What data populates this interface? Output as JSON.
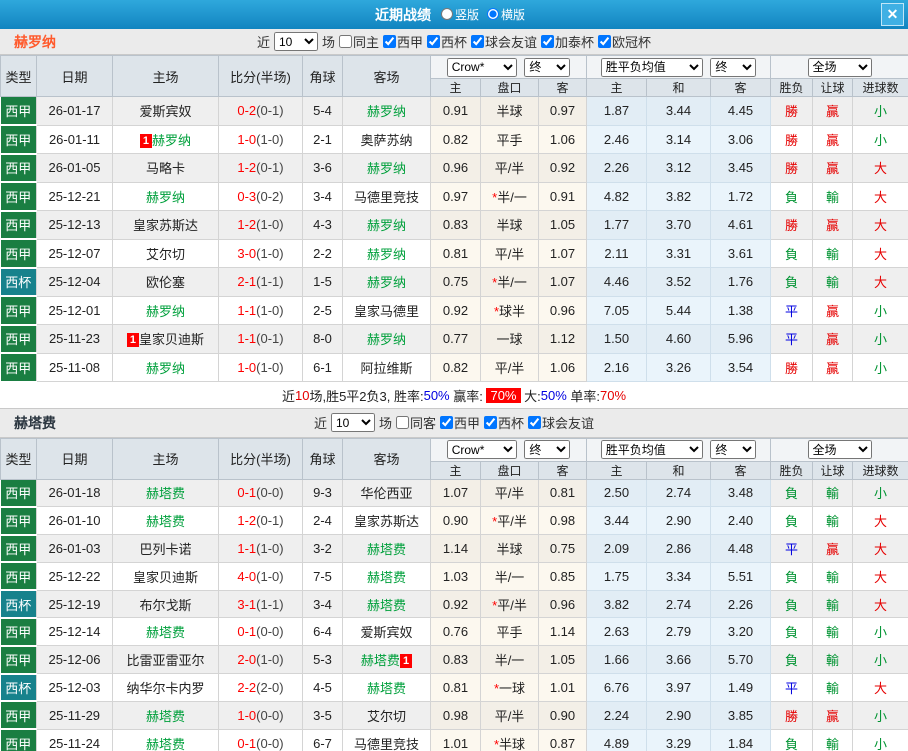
{
  "titlebar": {
    "title": "近期战绩",
    "modes": [
      {
        "label": "竖版",
        "checked": false
      },
      {
        "label": "横版",
        "checked": true
      }
    ],
    "close": "✕"
  },
  "colors": {
    "titlebar_blue": "#1b96cf",
    "win_red": "#e60000",
    "lose_green": "#009432",
    "draw_blue": "#0000e0",
    "highlight_team_green": "#00a03c",
    "liga_badge_green": "#1a7e42",
    "cup_badge_teal": "#17828c",
    "team_a_orange": "#ff5a2c"
  },
  "sections": [
    {
      "team": "赫罗纳",
      "filter": {
        "prefix": "近",
        "count": "10",
        "suffix": "场",
        "same_label": "同主",
        "same_checked": false,
        "comps": [
          {
            "label": "西甲",
            "checked": true
          },
          {
            "label": "西杯",
            "checked": true
          },
          {
            "label": "球会友谊",
            "checked": true
          },
          {
            "label": "加泰杯",
            "checked": true
          },
          {
            "label": "欧冠杯",
            "checked": true
          }
        ]
      },
      "selects": {
        "odds": "Crow*",
        "final1": "终",
        "avg": "胜平负均值",
        "final2": "终",
        "scope": "全场"
      },
      "columns": {
        "type": "类型",
        "date": "日期",
        "home": "主场",
        "score": "比分(半场)",
        "corner": "角球",
        "away": "客场",
        "o_home": "主",
        "handicap": "盘口",
        "o_away": "客",
        "avg_home": "主",
        "avg_draw": "和",
        "avg_away": "客",
        "wdl": "胜负",
        "cover": "让球",
        "goals": "进球数"
      },
      "rows": [
        {
          "type": "西甲",
          "type_class": "t-liga",
          "date": "26-01-17",
          "home": "爱斯宾奴",
          "home_class": "",
          "home_badge": "",
          "score": "0-2",
          "half": "(0-1)",
          "corner": "5-4",
          "away": "赫罗纳",
          "away_class": "c-hl",
          "away_badge": "",
          "o1": "0.91",
          "star": "",
          "hcap": "半球",
          "o2": "0.97",
          "a1": "1.87",
          "a2": "3.44",
          "a3": "4.45",
          "wdl": "勝",
          "wdl_class": "c-red",
          "cover": "贏",
          "cover_class": "c-red",
          "ou": "小",
          "ou_class": "c-green"
        },
        {
          "type": "西甲",
          "type_class": "t-liga",
          "date": "26-01-11",
          "home": "赫罗纳",
          "home_class": "c-hl",
          "home_badge": "1",
          "score": "1-0",
          "half": "(1-0)",
          "corner": "2-1",
          "away": "奥萨苏纳",
          "away_class": "",
          "away_badge": "",
          "o1": "0.82",
          "star": "",
          "hcap": "平手",
          "o2": "1.06",
          "a1": "2.46",
          "a2": "3.14",
          "a3": "3.06",
          "wdl": "勝",
          "wdl_class": "c-red",
          "cover": "贏",
          "cover_class": "c-red",
          "ou": "小",
          "ou_class": "c-green"
        },
        {
          "type": "西甲",
          "type_class": "t-liga",
          "date": "26-01-05",
          "home": "马略卡",
          "home_class": "",
          "home_badge": "",
          "score": "1-2",
          "half": "(0-1)",
          "corner": "3-6",
          "away": "赫罗纳",
          "away_class": "c-hl",
          "away_badge": "",
          "o1": "0.96",
          "star": "",
          "hcap": "平/半",
          "o2": "0.92",
          "a1": "2.26",
          "a2": "3.12",
          "a3": "3.45",
          "wdl": "勝",
          "wdl_class": "c-red",
          "cover": "贏",
          "cover_class": "c-red",
          "ou": "大",
          "ou_class": "c-red"
        },
        {
          "type": "西甲",
          "type_class": "t-liga",
          "date": "25-12-21",
          "home": "赫罗纳",
          "home_class": "c-hl",
          "home_badge": "",
          "score": "0-3",
          "half": "(0-2)",
          "corner": "3-4",
          "away": "马德里竞技",
          "away_class": "",
          "away_badge": "",
          "o1": "0.97",
          "star": "*",
          "hcap": "半/一",
          "o2": "0.91",
          "a1": "4.82",
          "a2": "3.82",
          "a3": "1.72",
          "wdl": "負",
          "wdl_class": "c-green",
          "cover": "輸",
          "cover_class": "c-green",
          "ou": "大",
          "ou_class": "c-red"
        },
        {
          "type": "西甲",
          "type_class": "t-liga",
          "date": "25-12-13",
          "home": "皇家苏斯达",
          "home_class": "",
          "home_badge": "",
          "score": "1-2",
          "half": "(1-0)",
          "corner": "4-3",
          "away": "赫罗纳",
          "away_class": "c-hl",
          "away_badge": "",
          "o1": "0.83",
          "star": "",
          "hcap": "半球",
          "o2": "1.05",
          "a1": "1.77",
          "a2": "3.70",
          "a3": "4.61",
          "wdl": "勝",
          "wdl_class": "c-red",
          "cover": "贏",
          "cover_class": "c-red",
          "ou": "大",
          "ou_class": "c-red"
        },
        {
          "type": "西甲",
          "type_class": "t-liga",
          "date": "25-12-07",
          "home": "艾尔切",
          "home_class": "",
          "home_badge": "",
          "score": "3-0",
          "half": "(1-0)",
          "corner": "2-2",
          "away": "赫罗纳",
          "away_class": "c-hl",
          "away_badge": "",
          "o1": "0.81",
          "star": "",
          "hcap": "平/半",
          "o2": "1.07",
          "a1": "2.11",
          "a2": "3.31",
          "a3": "3.61",
          "wdl": "負",
          "wdl_class": "c-green",
          "cover": "輸",
          "cover_class": "c-green",
          "ou": "大",
          "ou_class": "c-red"
        },
        {
          "type": "西杯",
          "type_class": "t-cup",
          "date": "25-12-04",
          "home": "欧伦塞",
          "home_class": "",
          "home_badge": "",
          "score": "2-1",
          "half": "(1-1)",
          "corner": "1-5",
          "away": "赫罗纳",
          "away_class": "c-hl",
          "away_badge": "",
          "o1": "0.75",
          "star": "*",
          "hcap": "半/一",
          "o2": "1.07",
          "a1": "4.46",
          "a2": "3.52",
          "a3": "1.76",
          "wdl": "負",
          "wdl_class": "c-green",
          "cover": "輸",
          "cover_class": "c-green",
          "ou": "大",
          "ou_class": "c-red"
        },
        {
          "type": "西甲",
          "type_class": "t-liga",
          "date": "25-12-01",
          "home": "赫罗纳",
          "home_class": "c-hl",
          "home_badge": "",
          "score": "1-1",
          "half": "(1-0)",
          "corner": "2-5",
          "away": "皇家马德里",
          "away_class": "",
          "away_badge": "",
          "o1": "0.92",
          "star": "*",
          "hcap": "球半",
          "o2": "0.96",
          "a1": "7.05",
          "a2": "5.44",
          "a3": "1.38",
          "wdl": "平",
          "wdl_class": "c-blue",
          "cover": "贏",
          "cover_class": "c-red",
          "ou": "小",
          "ou_class": "c-green"
        },
        {
          "type": "西甲",
          "type_class": "t-liga",
          "date": "25-11-23",
          "home": "皇家贝迪斯",
          "home_class": "",
          "home_badge": "1",
          "score": "1-1",
          "half": "(0-1)",
          "corner": "8-0",
          "away": "赫罗纳",
          "away_class": "c-hl",
          "away_badge": "",
          "o1": "0.77",
          "star": "",
          "hcap": "一球",
          "o2": "1.12",
          "a1": "1.50",
          "a2": "4.60",
          "a3": "5.96",
          "wdl": "平",
          "wdl_class": "c-blue",
          "cover": "贏",
          "cover_class": "c-red",
          "ou": "小",
          "ou_class": "c-green"
        },
        {
          "type": "西甲",
          "type_class": "t-liga",
          "date": "25-11-08",
          "home": "赫罗纳",
          "home_class": "c-hl",
          "home_badge": "",
          "score": "1-0",
          "half": "(1-0)",
          "corner": "6-1",
          "away": "阿拉维斯",
          "away_class": "",
          "away_badge": "",
          "o1": "0.82",
          "star": "",
          "hcap": "平/半",
          "o2": "1.06",
          "a1": "2.16",
          "a2": "3.26",
          "a3": "3.54",
          "wdl": "勝",
          "wdl_class": "c-red",
          "cover": "贏",
          "cover_class": "c-red",
          "ou": "小",
          "ou_class": "c-green"
        }
      ],
      "summary": [
        {
          "text": "近",
          "class": ""
        },
        {
          "text": "10",
          "class": "c-red"
        },
        {
          "text": "场,胜5平2负3, 胜率:",
          "class": ""
        },
        {
          "text": "50%",
          "class": "c-blue"
        },
        {
          "text": " 赢率: ",
          "class": ""
        },
        {
          "text": "70%",
          "class": "sum-badge"
        },
        {
          "text": " 大:",
          "class": ""
        },
        {
          "text": "50%",
          "class": "c-blue"
        },
        {
          "text": " 单率:",
          "class": ""
        },
        {
          "text": "70%",
          "class": "c-red"
        }
      ]
    },
    {
      "team": "赫塔费",
      "filter": {
        "prefix": "近",
        "count": "10",
        "suffix": "场",
        "same_label": "同客",
        "same_checked": false,
        "comps": [
          {
            "label": "西甲",
            "checked": true
          },
          {
            "label": "西杯",
            "checked": true
          },
          {
            "label": "球会友谊",
            "checked": true
          }
        ]
      },
      "selects": {
        "odds": "Crow*",
        "final1": "终",
        "avg": "胜平负均值",
        "final2": "终",
        "scope": "全场"
      },
      "columns": {
        "type": "类型",
        "date": "日期",
        "home": "主场",
        "score": "比分(半场)",
        "corner": "角球",
        "away": "客场",
        "o_home": "主",
        "handicap": "盘口",
        "o_away": "客",
        "avg_home": "主",
        "avg_draw": "和",
        "avg_away": "客",
        "wdl": "胜负",
        "cover": "让球",
        "goals": "进球数"
      },
      "rows": [
        {
          "type": "西甲",
          "type_class": "t-liga",
          "date": "26-01-18",
          "home": "赫塔费",
          "home_class": "c-hl",
          "home_badge": "",
          "score": "0-1",
          "half": "(0-0)",
          "corner": "9-3",
          "away": "华伦西亚",
          "away_class": "",
          "away_badge": "",
          "o1": "1.07",
          "star": "",
          "hcap": "平/半",
          "o2": "0.81",
          "a1": "2.50",
          "a2": "2.74",
          "a3": "3.48",
          "wdl": "負",
          "wdl_class": "c-green",
          "cover": "輸",
          "cover_class": "c-green",
          "ou": "小",
          "ou_class": "c-green"
        },
        {
          "type": "西甲",
          "type_class": "t-liga",
          "date": "26-01-10",
          "home": "赫塔费",
          "home_class": "c-hl",
          "home_badge": "",
          "score": "1-2",
          "half": "(0-1)",
          "corner": "2-4",
          "away": "皇家苏斯达",
          "away_class": "",
          "away_badge": "",
          "o1": "0.90",
          "star": "*",
          "hcap": "平/半",
          "o2": "0.98",
          "a1": "3.44",
          "a2": "2.90",
          "a3": "2.40",
          "wdl": "負",
          "wdl_class": "c-green",
          "cover": "輸",
          "cover_class": "c-green",
          "ou": "大",
          "ou_class": "c-red"
        },
        {
          "type": "西甲",
          "type_class": "t-liga",
          "date": "26-01-03",
          "home": "巴列卡诺",
          "home_class": "",
          "home_badge": "",
          "score": "1-1",
          "half": "(1-0)",
          "corner": "3-2",
          "away": "赫塔费",
          "away_class": "c-hl",
          "away_badge": "",
          "o1": "1.14",
          "star": "",
          "hcap": "半球",
          "o2": "0.75",
          "a1": "2.09",
          "a2": "2.86",
          "a3": "4.48",
          "wdl": "平",
          "wdl_class": "c-blue",
          "cover": "贏",
          "cover_class": "c-red",
          "ou": "大",
          "ou_class": "c-red"
        },
        {
          "type": "西甲",
          "type_class": "t-liga",
          "date": "25-12-22",
          "home": "皇家贝迪斯",
          "home_class": "",
          "home_badge": "",
          "score": "4-0",
          "half": "(1-0)",
          "corner": "7-5",
          "away": "赫塔费",
          "away_class": "c-hl",
          "away_badge": "",
          "o1": "1.03",
          "star": "",
          "hcap": "半/一",
          "o2": "0.85",
          "a1": "1.75",
          "a2": "3.34",
          "a3": "5.51",
          "wdl": "負",
          "wdl_class": "c-green",
          "cover": "輸",
          "cover_class": "c-green",
          "ou": "大",
          "ou_class": "c-red"
        },
        {
          "type": "西杯",
          "type_class": "t-cup",
          "date": "25-12-19",
          "home": "布尔戈斯",
          "home_class": "",
          "home_badge": "",
          "score": "3-1",
          "half": "(1-1)",
          "corner": "3-4",
          "away": "赫塔费",
          "away_class": "c-hl",
          "away_badge": "",
          "o1": "0.92",
          "star": "*",
          "hcap": "平/半",
          "o2": "0.96",
          "a1": "3.82",
          "a2": "2.74",
          "a3": "2.26",
          "wdl": "負",
          "wdl_class": "c-green",
          "cover": "輸",
          "cover_class": "c-green",
          "ou": "大",
          "ou_class": "c-red"
        },
        {
          "type": "西甲",
          "type_class": "t-liga",
          "date": "25-12-14",
          "home": "赫塔费",
          "home_class": "c-hl",
          "home_badge": "",
          "score": "0-1",
          "half": "(0-0)",
          "corner": "6-4",
          "away": "爱斯宾奴",
          "away_class": "",
          "away_badge": "",
          "o1": "0.76",
          "star": "",
          "hcap": "平手",
          "o2": "1.14",
          "a1": "2.63",
          "a2": "2.79",
          "a3": "3.20",
          "wdl": "負",
          "wdl_class": "c-green",
          "cover": "輸",
          "cover_class": "c-green",
          "ou": "小",
          "ou_class": "c-green"
        },
        {
          "type": "西甲",
          "type_class": "t-liga",
          "date": "25-12-06",
          "home": "比雷亚雷亚尔",
          "home_class": "",
          "home_badge": "",
          "score": "2-0",
          "half": "(1-0)",
          "corner": "5-3",
          "away": "赫塔费",
          "away_class": "c-hl",
          "away_badge": "1",
          "o1": "0.83",
          "star": "",
          "hcap": "半/一",
          "o2": "1.05",
          "a1": "1.66",
          "a2": "3.66",
          "a3": "5.70",
          "wdl": "負",
          "wdl_class": "c-green",
          "cover": "輸",
          "cover_class": "c-green",
          "ou": "小",
          "ou_class": "c-green"
        },
        {
          "type": "西杯",
          "type_class": "t-cup",
          "date": "25-12-03",
          "home": "纳华尔卡内罗",
          "home_class": "",
          "home_badge": "",
          "score": "2-2",
          "half": "(2-0)",
          "corner": "4-5",
          "away": "赫塔费",
          "away_class": "c-hl",
          "away_badge": "",
          "o1": "0.81",
          "star": "*",
          "hcap": "一球",
          "o2": "1.01",
          "a1": "6.76",
          "a2": "3.97",
          "a3": "1.49",
          "wdl": "平",
          "wdl_class": "c-blue",
          "cover": "輸",
          "cover_class": "c-green",
          "ou": "大",
          "ou_class": "c-red"
        },
        {
          "type": "西甲",
          "type_class": "t-liga",
          "date": "25-11-29",
          "home": "赫塔费",
          "home_class": "c-hl",
          "home_badge": "",
          "score": "1-0",
          "half": "(0-0)",
          "corner": "3-5",
          "away": "艾尔切",
          "away_class": "",
          "away_badge": "",
          "o1": "0.98",
          "star": "",
          "hcap": "平/半",
          "o2": "0.90",
          "a1": "2.24",
          "a2": "2.90",
          "a3": "3.85",
          "wdl": "勝",
          "wdl_class": "c-red",
          "cover": "贏",
          "cover_class": "c-red",
          "ou": "小",
          "ou_class": "c-green"
        },
        {
          "type": "西甲",
          "type_class": "t-liga",
          "date": "25-11-24",
          "home": "赫塔费",
          "home_class": "c-hl",
          "home_badge": "",
          "score": "0-1",
          "half": "(0-0)",
          "corner": "6-7",
          "away": "马德里竞技",
          "away_class": "",
          "away_badge": "",
          "o1": "1.01",
          "star": "*",
          "hcap": "半球",
          "o2": "0.87",
          "a1": "4.89",
          "a2": "3.29",
          "a3": "1.84",
          "wdl": "負",
          "wdl_class": "c-green",
          "cover": "輸",
          "cover_class": "c-green",
          "ou": "小",
          "ou_class": "c-green"
        }
      ]
    }
  ]
}
